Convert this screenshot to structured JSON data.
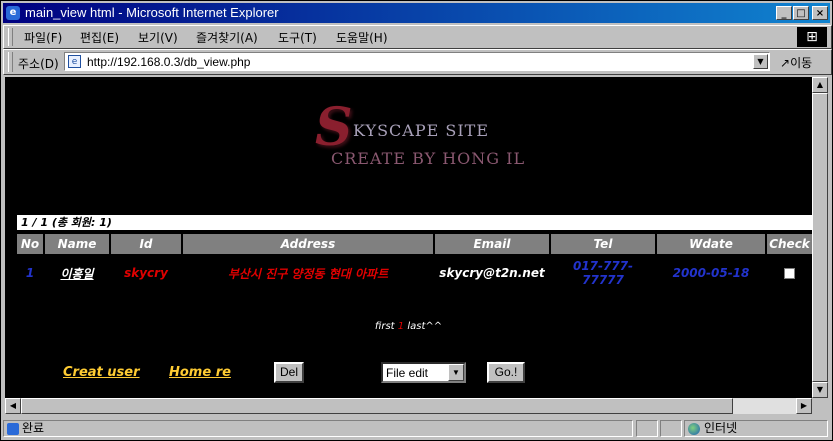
{
  "window": {
    "title": "main_view html - Microsoft Internet Explorer",
    "controls": {
      "minimize": "_",
      "maximize": "□",
      "close": "×"
    }
  },
  "menu": {
    "items": [
      "파일(F)",
      "편집(E)",
      "보기(V)",
      "즐겨찾기(A)",
      "도구(T)",
      "도움말(H)"
    ]
  },
  "address": {
    "label": "주소(D)",
    "url": "http://192.168.0.3/db_view.php",
    "go_label": "이동"
  },
  "site": {
    "logo_letter": "S",
    "logo_line1": "KYSCAPE SITE",
    "logo_line2": "CREATE BY HONG IL"
  },
  "page_info": "1 / 1 (총 회원: 1)",
  "table": {
    "columns": [
      "No",
      "Name",
      "Id",
      "Address",
      "Email",
      "Tel",
      "Wdate",
      "Check"
    ],
    "row": {
      "no": "1",
      "name": "이홍일",
      "id": "skycry",
      "address": "부산시 진구 양정동 현대 아파트",
      "email": "skycry@t2n.net",
      "tel": "017-777-77777",
      "wdate": "2000-05-18",
      "checked": false
    }
  },
  "pager": {
    "first": "first",
    "current": "1",
    "last": "last^^"
  },
  "actions": {
    "create_user": "Creat user",
    "home": "Home re",
    "del_button": "Del",
    "select_value": "File edit",
    "go_button": "Go.!"
  },
  "status": {
    "text": "완료",
    "zone": "인터넷"
  },
  "colors": {
    "title_start": "#000080",
    "title_end": "#1084d0",
    "no_color": "#2233cc",
    "name_color": "#ffffff",
    "id_color": "#e00000",
    "address_color": "#e00000",
    "email_color": "#ffffff",
    "tel_color": "#2233cc",
    "wdate_color": "#2233cc",
    "link_color": "#ffcc33"
  }
}
